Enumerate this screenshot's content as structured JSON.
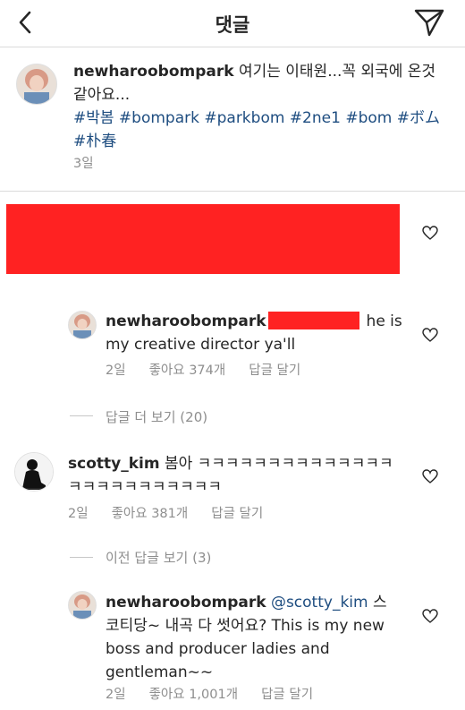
{
  "header": {
    "title": "댓글"
  },
  "post": {
    "username": "newharoobompark",
    "caption": " 여기는 이태원...꼭 외국에 온것같아요...",
    "hashtags": "#박봄 #bompark #parkbom #2ne1 #bom #ボム #朴春",
    "time": "3일"
  },
  "comments": [
    {
      "username": "newharoobompark",
      "text_after": "he is my creative director ya'll",
      "time": "2일",
      "likes": "좋아요 374개",
      "reply": "답글 달기"
    },
    {
      "username": "scotty_kim",
      "text": " 봄아 ㅋㅋㅋㅋㅋㅋㅋㅋㅋㅋㅋㅋㅋㅋㅋㅋㅋㅋㅋㅋㅋㅋㅋㅋㅋ",
      "time": "2일",
      "likes": "좋아요 381개",
      "reply": "답글 달기"
    },
    {
      "username": "newharoobompark",
      "mention": "@scotty_kim",
      "text": " 스코티당~ 내곡 다 썻어요? This is my new boss and producer ladies and gentleman~~",
      "time": "2일",
      "likes": "좋아요 1,001개",
      "reply": "답글 달기"
    }
  ],
  "view_more_replies": "답글 더 보기 (20)",
  "view_previous_replies": "이전 답글 보기 (3)",
  "colors": {
    "redaction": "#ff2222",
    "hashtag": "#1e4d80",
    "meta": "#8e8e8e"
  }
}
